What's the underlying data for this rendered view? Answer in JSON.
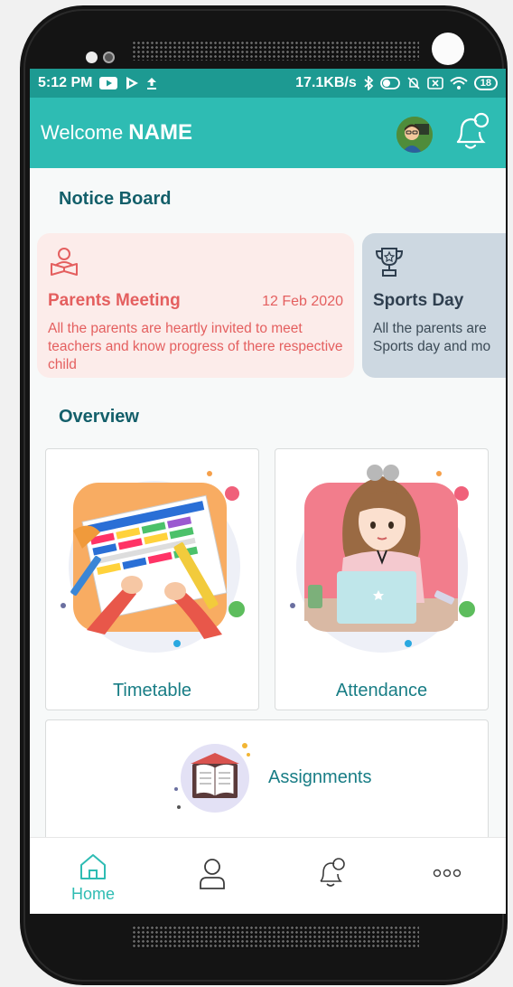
{
  "status_bar": {
    "time": "5:12 PM",
    "net_speed": "17.1KB/s",
    "battery": "18"
  },
  "app_bar": {
    "welcome_label": "Welcome",
    "user_name": "NAME"
  },
  "notice_board": {
    "title": "Notice Board",
    "notices": [
      {
        "icon": "reading-person-icon",
        "title": "Parents Meeting",
        "date": "12 Feb 2020",
        "body": "All the parents are heartly invited to meet teachers and know progress of there respective child"
      },
      {
        "icon": "trophy-icon",
        "title": "Sports Day",
        "body_line1": "All the parents are",
        "body_line2": "Sports day and mo"
      }
    ]
  },
  "overview": {
    "title": "Overview",
    "tiles": [
      {
        "label": "Timetable"
      },
      {
        "label": "Attendance"
      },
      {
        "label": "Assignments"
      }
    ]
  },
  "bottom_nav": {
    "items": [
      {
        "label": "Home",
        "icon": "home-icon",
        "active": true
      },
      {
        "label": "",
        "icon": "profile-icon"
      },
      {
        "label": "",
        "icon": "bell-icon"
      },
      {
        "label": "",
        "icon": "more-icon"
      }
    ]
  },
  "colors": {
    "primary": "#2ebcb3",
    "status_bar": "#1d9a92",
    "accent_text": "#187d85",
    "notice_pink_bg": "#fcecea",
    "notice_red": "#e45f5f",
    "notice_blue_bg": "#cdd8e1"
  }
}
